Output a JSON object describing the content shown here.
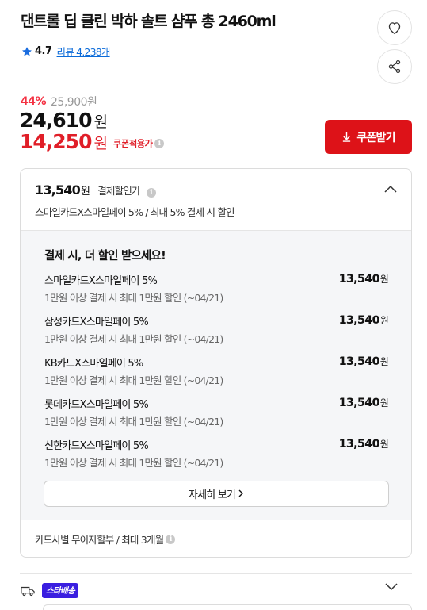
{
  "product": {
    "title": "댄트롤 딥 클린 박하 솔트 샴푸 총 2460ml",
    "rating": "4.7",
    "review_link": "리뷰 4,238개"
  },
  "price": {
    "discount_rate": "44%",
    "original": "25,900원",
    "sale_amount": "24,610",
    "won": "원",
    "coupon_amount": "14,250",
    "coupon_label": "쿠폰적용가"
  },
  "coupon_button": {
    "label": "쿠폰받기"
  },
  "payment": {
    "amount": "13,540",
    "won": "원",
    "label": "결제할인가",
    "subtitle": "스마일카드X스마일페이 5% / 최대 5% 결제 시 할인",
    "panel_title": "결제 시, 더 할인 받으세요!",
    "cards": [
      {
        "name": "스마일카드X스마일페이 5%",
        "desc": "1만원 이상 결제 시 최대 1만원 할인 (~04/21)",
        "amount": "13,540",
        "won": "원"
      },
      {
        "name": "삼성카드X스마일페이 5%",
        "desc": "1만원 이상 결제 시 최대 1만원 할인 (~04/21)",
        "amount": "13,540",
        "won": "원"
      },
      {
        "name": "KB카드X스마일페이 5%",
        "desc": "1만원 이상 결제 시 최대 1만원 할인 (~04/21)",
        "amount": "13,540",
        "won": "원"
      },
      {
        "name": "롯데카드X스마일페이 5%",
        "desc": "1만원 이상 결제 시 최대 1만원 할인 (~04/21)",
        "amount": "13,540",
        "won": "원"
      },
      {
        "name": "신한카드X스마일페이 5%",
        "desc": "1만원 이상 결제 시 최대 1만원 할인 (~04/21)",
        "amount": "13,540",
        "won": "원"
      }
    ],
    "detail_button": "자세히 보기",
    "installment": "카드사별 무이자할부 / 최대 3개월"
  },
  "delivery": {
    "badge": "스타배송"
  },
  "icons": {
    "heart": "heart-icon",
    "share": "share-icon",
    "star": "star-icon",
    "info": "info-icon",
    "download": "download-icon",
    "chevron_up": "chevron-up-icon",
    "chevron_right": "chevron-right-icon",
    "truck": "truck-icon",
    "chevron_down": "chevron-down-icon"
  },
  "colors": {
    "accent_red": "#dd1218",
    "price_red": "#e01e28",
    "discount_red": "#f43142",
    "link_blue": "#0b6bd9",
    "star_blue": "#1a6ddf",
    "badge_purple": "#3a1ee0"
  }
}
